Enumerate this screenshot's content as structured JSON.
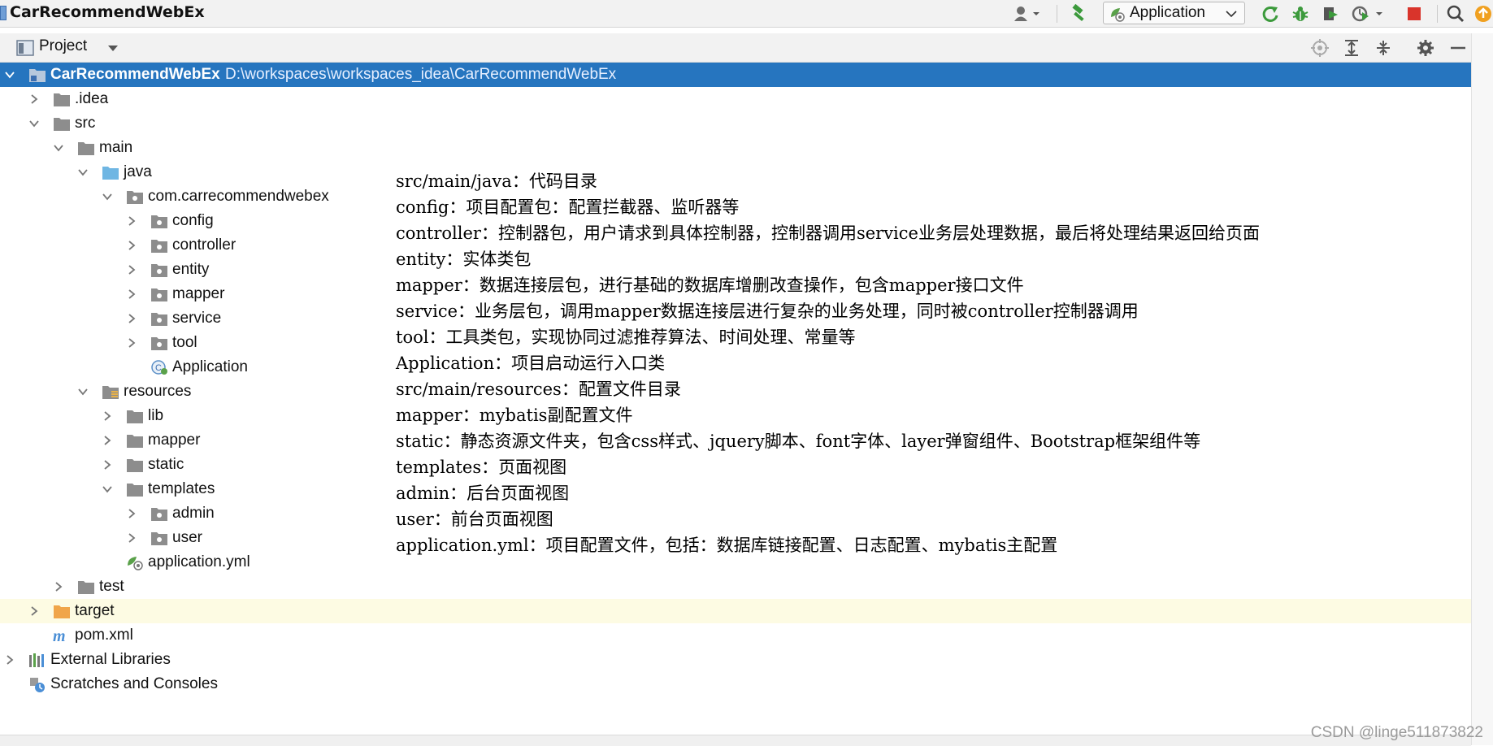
{
  "window": {
    "project_name": "CarRecommendWebEx",
    "run_config": "Application"
  },
  "colors": {
    "selection": "#2675bf",
    "highlight_row": "#fdfbe3",
    "folder_gray": "#8d8d8d",
    "folder_blue": "#6fb6e3",
    "folder_orange": "#f0a54a",
    "run_green": "#3c9a3c",
    "stop_red": "#d9342b"
  },
  "project_panel": {
    "title": "Project"
  },
  "tree": {
    "root": {
      "name": "CarRecommendWebEx",
      "path": "D:\\workspaces\\workspaces_idea\\CarRecommendWebEx"
    },
    "idea": ".idea",
    "src": "src",
    "main": "main",
    "java": "java",
    "package": "com.carrecommendwebex",
    "config": "config",
    "controller": "controller",
    "entity": "entity",
    "mapper": "mapper",
    "service": "service",
    "tool": "tool",
    "application": "Application",
    "resources": "resources",
    "lib": "lib",
    "res_mapper": "mapper",
    "static": "static",
    "templates": "templates",
    "admin": "admin",
    "user": "user",
    "application_yml": "application.yml",
    "test": "test",
    "target": "target",
    "pom": "pom.xml",
    "external_libraries": "External Libraries",
    "scratches": "Scratches and Consoles"
  },
  "annotations": [
    "src/main/java：代码目录",
    "config：项目配置包：配置拦截器、监听器等",
    "controller：控制器包，用户请求到具体控制器，控制器调用service业务层处理数据，最后将处理结果返回给页面",
    "entity：实体类包",
    "mapper：数据连接层包，进行基础的数据库增删改查操作，包含mapper接口文件",
    "service：业务层包，调用mapper数据连接层进行复杂的业务处理，同时被controller控制器调用",
    "tool：工具类包，实现协同过滤推荐算法、时间处理、常量等",
    "Application：项目启动运行入口类",
    "src/main/resources：配置文件目录",
    "mapper：mybatis副配置文件",
    "static：静态资源文件夹，包含css样式、jquery脚本、font字体、layer弹窗组件、Bootstrap框架组件等",
    "templates：页面视图",
    "admin：后台页面视图",
    "user：前台页面视图",
    "application.yml：项目配置文件，包括：数据库链接配置、日志配置、mybatis主配置"
  ],
  "watermark": "CSDN @linge511873822"
}
